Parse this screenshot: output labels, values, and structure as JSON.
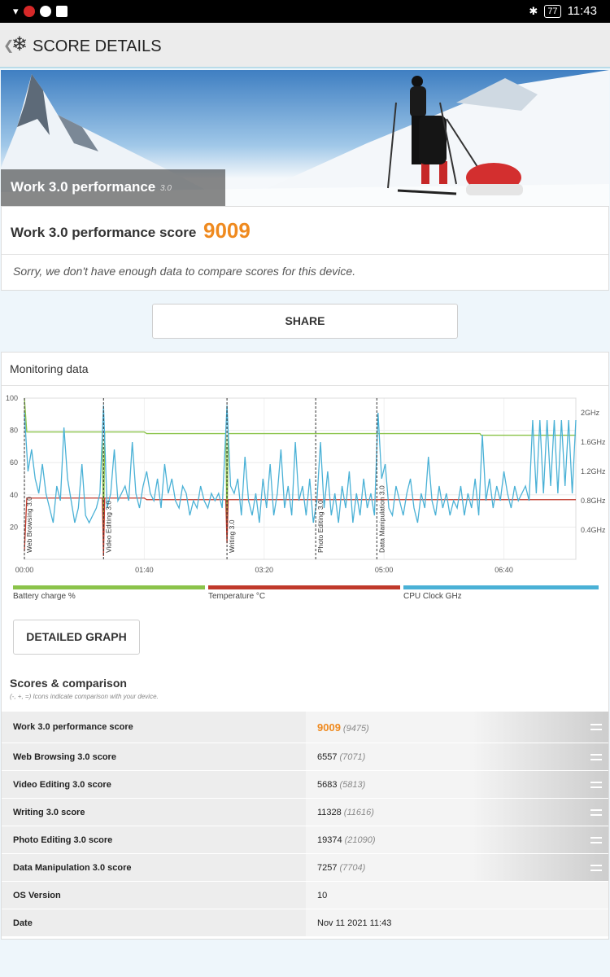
{
  "status_bar": {
    "battery": "77",
    "time": "11:43"
  },
  "app_bar": {
    "title": "SCORE DETAILS"
  },
  "hero": {
    "title": "Work 3.0 performance",
    "version": "3.0"
  },
  "score": {
    "label": "Work 3.0 performance score",
    "value": "9009",
    "note": "Sorry, we don't have enough data to compare scores for this device."
  },
  "share_label": "SHARE",
  "monitoring": {
    "title": "Monitoring data",
    "legend": [
      {
        "label": "Battery charge %",
        "color": "#8bc34a"
      },
      {
        "label": "Temperature °C",
        "color": "#c0392b"
      },
      {
        "label": "CPU Clock GHz",
        "color": "#4ab1d6"
      }
    ]
  },
  "chart_data": {
    "type": "line",
    "x_ticks": [
      "00:00",
      "01:40",
      "03:20",
      "05:00",
      "06:40"
    ],
    "y_left_ticks": [
      "100",
      "80",
      "60",
      "40",
      "20"
    ],
    "y_right_ticks": [
      "2GHz",
      "1.6GHz",
      "1.2GHz",
      "0.8GHz",
      "0.4GHz"
    ],
    "xlim_seconds": [
      0,
      460
    ],
    "ylim_percent": [
      0,
      100
    ],
    "ylim_ghz": [
      0,
      2.2
    ],
    "markers": [
      {
        "label": "Web Browsing 3.0",
        "t": 0
      },
      {
        "label": "Video Editing 3.0",
        "t": 66
      },
      {
        "label": "Writing 3.0",
        "t": 169
      },
      {
        "label": "Photo Editing 3.0",
        "t": 243
      },
      {
        "label": "Data Manipulation 3.0",
        "t": 294
      }
    ],
    "series": [
      {
        "name": "Battery charge %",
        "color": "#8bc34a",
        "points": [
          [
            0,
            100
          ],
          [
            2,
            79
          ],
          [
            65,
            79
          ],
          [
            66,
            10
          ],
          [
            67,
            79
          ],
          [
            100,
            79
          ],
          [
            102,
            78
          ],
          [
            168,
            78
          ],
          [
            169,
            15
          ],
          [
            170,
            78
          ],
          [
            380,
            78
          ],
          [
            381,
            77
          ],
          [
            460,
            77
          ]
        ]
      },
      {
        "name": "Temperature °C",
        "color": "#c0392b",
        "points": [
          [
            0,
            5
          ],
          [
            2,
            38
          ],
          [
            65,
            38
          ],
          [
            66,
            2
          ],
          [
            67,
            38
          ],
          [
            100,
            38
          ],
          [
            102,
            37
          ],
          [
            168,
            37
          ],
          [
            169,
            10
          ],
          [
            170,
            37
          ],
          [
            460,
            37
          ]
        ]
      },
      {
        "name": "CPU Clock GHz",
        "color": "#4ab1d6",
        "points": [
          [
            0,
            2.0
          ],
          [
            3,
            1.2
          ],
          [
            6,
            1.5
          ],
          [
            9,
            1.1
          ],
          [
            12,
            0.9
          ],
          [
            15,
            1.3
          ],
          [
            18,
            0.9
          ],
          [
            21,
            0.7
          ],
          [
            24,
            0.5
          ],
          [
            27,
            1.0
          ],
          [
            30,
            0.8
          ],
          [
            33,
            1.8
          ],
          [
            36,
            1.1
          ],
          [
            39,
            0.8
          ],
          [
            42,
            0.5
          ],
          [
            45,
            0.7
          ],
          [
            48,
            1.3
          ],
          [
            51,
            0.6
          ],
          [
            54,
            0.5
          ],
          [
            57,
            0.6
          ],
          [
            60,
            0.7
          ],
          [
            63,
            0.9
          ],
          [
            66,
            2.1
          ],
          [
            69,
            0.7
          ],
          [
            72,
            0.9
          ],
          [
            75,
            1.5
          ],
          [
            78,
            0.8
          ],
          [
            81,
            0.9
          ],
          [
            84,
            1.0
          ],
          [
            87,
            0.8
          ],
          [
            90,
            1.6
          ],
          [
            93,
            0.9
          ],
          [
            96,
            0.7
          ],
          [
            99,
            1.0
          ],
          [
            102,
            1.2
          ],
          [
            105,
            0.9
          ],
          [
            108,
            0.8
          ],
          [
            111,
            1.1
          ],
          [
            114,
            0.7
          ],
          [
            117,
            1.3
          ],
          [
            120,
            0.9
          ],
          [
            123,
            1.1
          ],
          [
            126,
            0.8
          ],
          [
            129,
            0.7
          ],
          [
            132,
            1.0
          ],
          [
            135,
            0.9
          ],
          [
            138,
            0.6
          ],
          [
            141,
            0.8
          ],
          [
            144,
            0.7
          ],
          [
            147,
            1.0
          ],
          [
            150,
            0.8
          ],
          [
            153,
            0.7
          ],
          [
            156,
            0.9
          ],
          [
            159,
            0.8
          ],
          [
            162,
            0.9
          ],
          [
            165,
            0.7
          ],
          [
            169,
            2.1
          ],
          [
            172,
            1.0
          ],
          [
            175,
            0.9
          ],
          [
            178,
            1.1
          ],
          [
            181,
            0.6
          ],
          [
            184,
            1.4
          ],
          [
            187,
            0.8
          ],
          [
            190,
            0.6
          ],
          [
            193,
            0.9
          ],
          [
            196,
            0.5
          ],
          [
            199,
            1.1
          ],
          [
            202,
            0.7
          ],
          [
            205,
            1.3
          ],
          [
            208,
            0.6
          ],
          [
            211,
            0.9
          ],
          [
            214,
            1.5
          ],
          [
            217,
            0.7
          ],
          [
            220,
            1.0
          ],
          [
            223,
            0.6
          ],
          [
            226,
            1.6
          ],
          [
            229,
            0.8
          ],
          [
            232,
            1.0
          ],
          [
            235,
            0.6
          ],
          [
            238,
            1.1
          ],
          [
            241,
            0.5
          ],
          [
            244,
            0.8
          ],
          [
            247,
            1.6
          ],
          [
            250,
            0.7
          ],
          [
            253,
            1.2
          ],
          [
            256,
            0.6
          ],
          [
            259,
            0.9
          ],
          [
            262,
            0.5
          ],
          [
            265,
            1.0
          ],
          [
            268,
            0.7
          ],
          [
            271,
            1.2
          ],
          [
            274,
            0.5
          ],
          [
            277,
            0.9
          ],
          [
            280,
            0.6
          ],
          [
            283,
            1.1
          ],
          [
            286,
            0.7
          ],
          [
            289,
            0.9
          ],
          [
            292,
            0.6
          ],
          [
            295,
            2.0
          ],
          [
            298,
            1.1
          ],
          [
            301,
            1.3
          ],
          [
            304,
            0.7
          ],
          [
            307,
            0.6
          ],
          [
            310,
            1.0
          ],
          [
            313,
            0.8
          ],
          [
            316,
            0.6
          ],
          [
            319,
            0.9
          ],
          [
            322,
            1.1
          ],
          [
            325,
            0.7
          ],
          [
            328,
            0.5
          ],
          [
            331,
            0.9
          ],
          [
            334,
            0.7
          ],
          [
            337,
            1.4
          ],
          [
            340,
            0.8
          ],
          [
            343,
            0.6
          ],
          [
            346,
            1.0
          ],
          [
            349,
            0.7
          ],
          [
            352,
            0.9
          ],
          [
            355,
            0.6
          ],
          [
            358,
            0.8
          ],
          [
            361,
            0.7
          ],
          [
            364,
            1.0
          ],
          [
            367,
            0.6
          ],
          [
            370,
            0.9
          ],
          [
            373,
            0.7
          ],
          [
            376,
            1.1
          ],
          [
            379,
            0.6
          ],
          [
            382,
            1.7
          ],
          [
            385,
            0.8
          ],
          [
            388,
            1.1
          ],
          [
            391,
            0.7
          ],
          [
            394,
            1.0
          ],
          [
            397,
            0.8
          ],
          [
            400,
            1.2
          ],
          [
            403,
            0.9
          ],
          [
            406,
            0.7
          ],
          [
            409,
            1.0
          ],
          [
            412,
            0.8
          ],
          [
            415,
            0.9
          ],
          [
            418,
            1.0
          ],
          [
            421,
            0.8
          ],
          [
            424,
            1.9
          ],
          [
            427,
            0.9
          ],
          [
            430,
            1.9
          ],
          [
            433,
            0.9
          ],
          [
            436,
            1.9
          ],
          [
            439,
            1.0
          ],
          [
            442,
            1.9
          ],
          [
            445,
            0.9
          ],
          [
            448,
            1.9
          ],
          [
            451,
            1.0
          ],
          [
            454,
            1.9
          ],
          [
            457,
            0.9
          ],
          [
            460,
            1.9
          ]
        ]
      }
    ]
  },
  "detailed_graph_label": "DETAILED GRAPH",
  "scores": {
    "title": "Scores & comparison",
    "subtitle": "(-, +, =) Icons indicate comparison with your device.",
    "rows": [
      {
        "name": "Work 3.0 performance score",
        "value": "9009",
        "avg": "(9475)",
        "icon": "equal-icon"
      },
      {
        "name": "Web Browsing 3.0 score",
        "value": "6557",
        "avg": "(7071)",
        "icon": "equal-icon"
      },
      {
        "name": "Video Editing 3.0 score",
        "value": "5683",
        "avg": "(5813)",
        "icon": "equal-icon"
      },
      {
        "name": "Writing 3.0 score",
        "value": "11328",
        "avg": "(11616)",
        "icon": "equal-icon"
      },
      {
        "name": "Photo Editing 3.0 score",
        "value": "19374",
        "avg": "(21090)",
        "icon": "equal-icon"
      },
      {
        "name": "Data Manipulation 3.0 score",
        "value": "7257",
        "avg": "(7704)",
        "icon": "equal-icon"
      },
      {
        "name": "OS Version",
        "value": "10",
        "avg": ""
      },
      {
        "name": "Date",
        "value": "Nov 11 2021 11:43",
        "avg": ""
      }
    ]
  }
}
